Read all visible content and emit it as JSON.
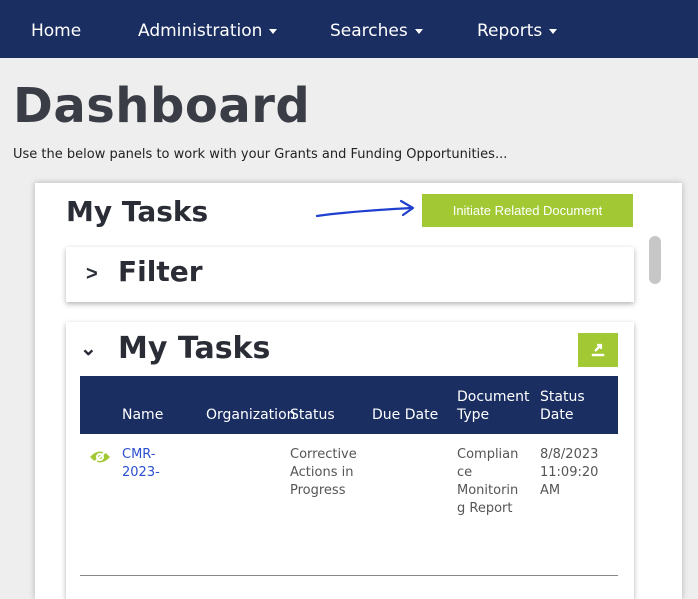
{
  "nav": {
    "home": "Home",
    "administration": "Administration",
    "searches": "Searches",
    "reports": "Reports"
  },
  "page": {
    "title": "Dashboard",
    "subtitle": "Use the below panels to work with your Grants and Funding Opportunities..."
  },
  "tasks_panel": {
    "header": "My Tasks",
    "initiate_button": "Initiate Related Document"
  },
  "filter": {
    "chevron": ">",
    "title": "Filter"
  },
  "my_tasks": {
    "chevron": "⌄",
    "title": "My Tasks",
    "columns": {
      "name": "Name",
      "organization": "Organization",
      "status": "Status",
      "due_date": "Due Date",
      "document_type_1": "Document",
      "document_type_2": "Type",
      "status_date_1": "Status",
      "status_date_2": "Date"
    },
    "rows": [
      {
        "name_1": "CMR-",
        "name_2": "2023-",
        "organization": "",
        "status_1": "Corrective",
        "status_2": "Actions in",
        "status_3": "Progress",
        "due_date": "",
        "doc_type_1": "Complian",
        "doc_type_2": "ce",
        "doc_type_3": "Monitorin",
        "doc_type_4": "g Report",
        "status_date_1": "8/8/2023",
        "status_date_2": "11:09:20",
        "status_date_3": "AM"
      }
    ]
  },
  "colors": {
    "navbar": "#1a2e62",
    "accent_green": "#a2c934",
    "link": "#2b4fcf",
    "annotation_arrow": "#1f3fcf"
  }
}
